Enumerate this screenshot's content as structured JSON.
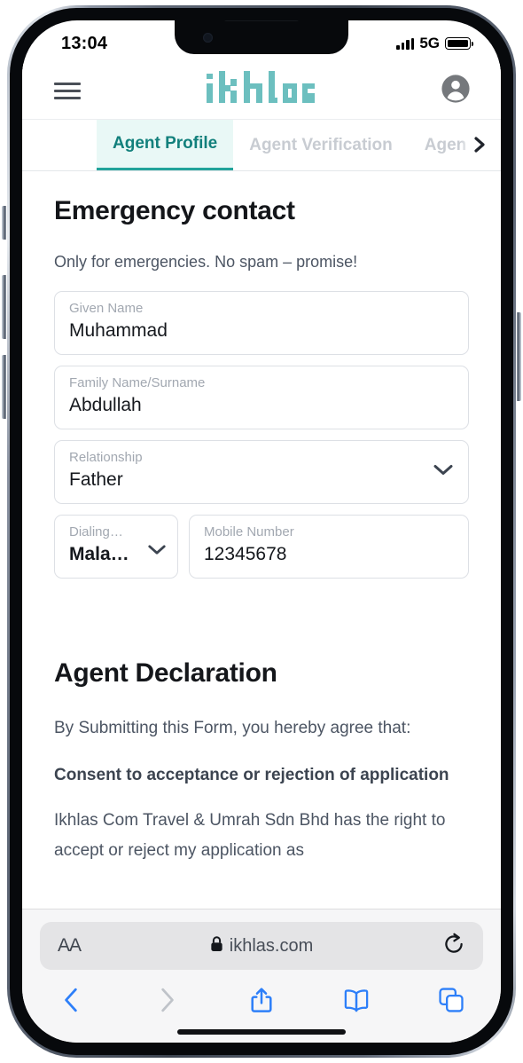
{
  "status_bar": {
    "time": "13:04",
    "network": "5G",
    "signal_icon": "signal-bars-icon",
    "battery_icon": "battery-full-icon"
  },
  "browser": {
    "url": "ikhlas.com",
    "lock_icon": "lock-icon",
    "text_size_label": "AA",
    "reload_icon": "reload-icon",
    "toolbar": {
      "back_icon": "chevron-left-icon",
      "forward_icon": "chevron-right-icon",
      "share_icon": "share-icon",
      "bookmarks_icon": "book-icon",
      "tabs_icon": "tabs-icon"
    }
  },
  "site": {
    "logo_text": "ikhlas",
    "menu_icon": "hamburger-menu-icon",
    "account_icon": "account-avatar-icon",
    "brand_teal": "#6CBFBF",
    "accent_teal": "#12807C"
  },
  "tabs": {
    "items": [
      {
        "label": "Agent Profile",
        "active": true
      },
      {
        "label": "Agent Verification",
        "active": false
      },
      {
        "label": "Agen",
        "active": false
      }
    ],
    "scroll_next_icon": "chevron-right-icon"
  },
  "emergency_contact": {
    "title": "Emergency contact",
    "subtitle": "Only for emergencies. No spam – promise!",
    "fields": [
      {
        "label": "Given Name",
        "value": "Muhammad",
        "type": "text"
      },
      {
        "label": "Family Name/Surname",
        "value": "Abdullah",
        "type": "text"
      },
      {
        "label": "Relationship",
        "value": "Father",
        "type": "select"
      }
    ],
    "dialing_code": {
      "label": "Dialing…",
      "value": "Mala…",
      "type": "select"
    },
    "mobile": {
      "label": "Mobile Number",
      "value": "12345678",
      "type": "text"
    }
  },
  "agent_declaration": {
    "title": "Agent Declaration",
    "lead": "By Submitting this Form, you hereby agree that:",
    "clause_heading": "Consent to acceptance or rejection of application",
    "clause_body": "Ikhlas Com Travel & Umrah Sdn Bhd has the right to accept or reject my application as"
  }
}
